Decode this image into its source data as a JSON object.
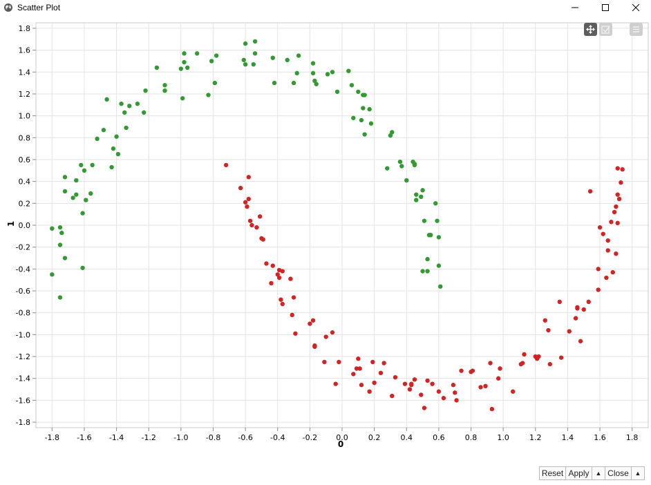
{
  "window": {
    "title": "Scatter Plot",
    "icon": "globe-icon",
    "controls": [
      "minimize-icon",
      "maximize-icon",
      "close-icon"
    ]
  },
  "toolbar": {
    "tools": [
      "pan-icon",
      "select-icon",
      "menu-icon"
    ]
  },
  "buttons": {
    "reset": "Reset",
    "apply": "Apply",
    "close": "Close",
    "apply_menu": "▲",
    "close_menu": "▲"
  },
  "colors": {
    "class_green": "#339933",
    "class_red": "#d22424",
    "grid": "#e3e3e3"
  },
  "chart_data": {
    "type": "scatter",
    "title": "",
    "xlabel": "0",
    "ylabel": "1",
    "xlim": [
      -1.9,
      1.9
    ],
    "ylim": [
      -1.85,
      1.85
    ],
    "xticks": [
      "-1.8",
      "-1.6",
      "-1.4",
      "-1.2",
      "-1.0",
      "-0.8",
      "-0.6",
      "-0.4",
      "-0.2",
      "0.0",
      "0.2",
      "0.4",
      "0.6",
      "0.8",
      "1.0",
      "1.2",
      "1.4",
      "1.6",
      "1.8"
    ],
    "yticks": [
      "1.8",
      "1.6",
      "1.4",
      "1.2",
      "1.0",
      "0.8",
      "0.6",
      "0.4",
      "0.2",
      "0.0",
      "-0.2",
      "-0.4",
      "-0.6",
      "-0.8",
      "-1.0",
      "-1.2",
      "-1.4",
      "-1.6",
      "-1.8"
    ],
    "grid": true,
    "series": [
      {
        "color": "#339933",
        "points": [
          [
            -1.8,
            -0.45
          ],
          [
            -1.8,
            -0.03
          ],
          [
            -1.75,
            -0.02
          ],
          [
            -1.74,
            -0.07
          ],
          [
            -1.75,
            -0.18
          ],
          [
            -1.75,
            -0.66
          ],
          [
            -1.72,
            -0.3
          ],
          [
            -1.72,
            0.44
          ],
          [
            -1.72,
            0.31
          ],
          [
            -1.67,
            0.25
          ],
          [
            -1.65,
            0.41
          ],
          [
            -1.65,
            0.28
          ],
          [
            -1.62,
            0.55
          ],
          [
            -1.61,
            0.11
          ],
          [
            -1.6,
            0.5
          ],
          [
            -1.59,
            0.23
          ],
          [
            -1.61,
            -0.39
          ],
          [
            -1.56,
            0.29
          ],
          [
            -1.55,
            0.55
          ],
          [
            -1.52,
            0.79
          ],
          [
            -1.48,
            0.87
          ],
          [
            -1.46,
            1.15
          ],
          [
            -1.43,
            0.53
          ],
          [
            -1.42,
            0.7
          ],
          [
            -1.4,
            0.81
          ],
          [
            -1.39,
            0.65
          ],
          [
            -1.37,
            1.11
          ],
          [
            -1.35,
            1.03
          ],
          [
            -1.34,
            0.89
          ],
          [
            -1.32,
            1.09
          ],
          [
            -1.27,
            1.11
          ],
          [
            -1.23,
            1.03
          ],
          [
            -1.22,
            1.23
          ],
          [
            -1.15,
            1.44
          ],
          [
            -1.1,
            1.23
          ],
          [
            -1.1,
            1.28
          ],
          [
            -1.0,
            1.43
          ],
          [
            -0.99,
            1.16
          ],
          [
            -0.98,
            1.57
          ],
          [
            -0.98,
            1.49
          ],
          [
            -0.96,
            1.44
          ],
          [
            -0.9,
            1.57
          ],
          [
            -0.83,
            1.19
          ],
          [
            -0.81,
            1.5
          ],
          [
            -0.79,
            1.3
          ],
          [
            -0.78,
            1.55
          ],
          [
            -0.61,
            1.51
          ],
          [
            -0.6,
            1.66
          ],
          [
            -0.6,
            1.47
          ],
          [
            -0.54,
            1.68
          ],
          [
            -0.54,
            1.57
          ],
          [
            -0.55,
            1.47
          ],
          [
            -0.43,
            1.53
          ],
          [
            -0.42,
            1.3
          ],
          [
            -0.34,
            1.51
          ],
          [
            -0.3,
            1.3
          ],
          [
            -0.28,
            1.39
          ],
          [
            -0.27,
            1.55
          ],
          [
            -0.18,
            1.48
          ],
          [
            -0.18,
            1.39
          ],
          [
            -0.17,
            1.32
          ],
          [
            -0.16,
            1.29
          ],
          [
            -0.09,
            1.38
          ],
          [
            -0.06,
            1.4
          ],
          [
            -0.03,
            1.22
          ],
          [
            0.04,
            1.41
          ],
          [
            0.06,
            1.28
          ],
          [
            0.07,
            0.98
          ],
          [
            0.1,
            1.22
          ],
          [
            0.12,
            0.96
          ],
          [
            0.13,
            1.19
          ],
          [
            0.13,
            1.07
          ],
          [
            0.14,
            0.83
          ],
          [
            0.14,
            1.19
          ],
          [
            0.17,
            1.06
          ],
          [
            0.18,
            0.93
          ],
          [
            0.28,
            0.52
          ],
          [
            0.3,
            0.82
          ],
          [
            0.31,
            0.85
          ],
          [
            0.36,
            0.58
          ],
          [
            0.37,
            0.54
          ],
          [
            0.4,
            0.41
          ],
          [
            0.44,
            0.58
          ],
          [
            0.45,
            0.55
          ],
          [
            0.45,
            0.56
          ],
          [
            0.46,
            0.28
          ],
          [
            0.46,
            0.23
          ],
          [
            0.49,
            0.26
          ],
          [
            0.5,
            0.32
          ],
          [
            0.51,
            0.04
          ],
          [
            0.5,
            -0.42
          ],
          [
            0.53,
            -0.31
          ],
          [
            0.53,
            -0.42
          ],
          [
            0.54,
            -0.09
          ],
          [
            0.55,
            -0.09
          ],
          [
            0.58,
            0.2
          ],
          [
            0.59,
            0.04
          ],
          [
            0.6,
            -0.11
          ],
          [
            0.6,
            -0.37
          ],
          [
            0.61,
            -0.56
          ]
        ]
      },
      {
        "color": "#d22424",
        "points": [
          [
            -0.72,
            0.55
          ],
          [
            -0.63,
            0.34
          ],
          [
            -0.6,
            0.21
          ],
          [
            -0.59,
            0.17
          ],
          [
            -0.58,
            0.24
          ],
          [
            -0.58,
            0.44
          ],
          [
            -0.57,
            0.04
          ],
          [
            -0.56,
            0.0
          ],
          [
            -0.53,
            -0.02
          ],
          [
            -0.51,
            0.08
          ],
          [
            -0.5,
            -0.12
          ],
          [
            -0.49,
            -0.13
          ],
          [
            -0.47,
            -0.35
          ],
          [
            -0.44,
            -0.53
          ],
          [
            -0.43,
            -0.37
          ],
          [
            -0.4,
            -0.45
          ],
          [
            -0.39,
            -0.48
          ],
          [
            -0.39,
            -0.41
          ],
          [
            -0.38,
            -0.68
          ],
          [
            -0.37,
            -0.72
          ],
          [
            -0.37,
            -0.42
          ],
          [
            -0.32,
            -0.49
          ],
          [
            -0.31,
            -0.82
          ],
          [
            -0.3,
            -0.66
          ],
          [
            -0.29,
            -0.99
          ],
          [
            -0.2,
            -0.9
          ],
          [
            -0.18,
            -0.87
          ],
          [
            -0.17,
            -1.1
          ],
          [
            -0.17,
            -1.11
          ],
          [
            -0.11,
            -1.25
          ],
          [
            -0.1,
            -1.02
          ],
          [
            -0.06,
            -0.98
          ],
          [
            -0.04,
            -1.45
          ],
          [
            -0.02,
            -1.25
          ],
          [
            0.07,
            -1.36
          ],
          [
            0.09,
            -1.31
          ],
          [
            0.1,
            -1.22
          ],
          [
            0.11,
            -1.31
          ],
          [
            0.12,
            -1.46
          ],
          [
            0.19,
            -1.25
          ],
          [
            0.2,
            -1.44
          ],
          [
            0.17,
            -1.52
          ],
          [
            0.24,
            -1.35
          ],
          [
            0.26,
            -1.26
          ],
          [
            0.31,
            -1.56
          ],
          [
            0.33,
            -1.39
          ],
          [
            0.39,
            -1.45
          ],
          [
            0.42,
            -1.5
          ],
          [
            0.43,
            -1.46
          ],
          [
            0.43,
            -1.45
          ],
          [
            0.45,
            -1.41
          ],
          [
            0.49,
            -1.55
          ],
          [
            0.51,
            -1.67
          ],
          [
            0.53,
            -1.42
          ],
          [
            0.56,
            -1.45
          ],
          [
            0.6,
            -1.52
          ],
          [
            0.63,
            -1.58
          ],
          [
            0.69,
            -1.46
          ],
          [
            0.7,
            -1.53
          ],
          [
            0.71,
            -1.6
          ],
          [
            0.74,
            -1.33
          ],
          [
            0.8,
            -1.34
          ],
          [
            0.81,
            -1.33
          ],
          [
            0.86,
            -1.48
          ],
          [
            0.89,
            -1.47
          ],
          [
            0.92,
            -1.26
          ],
          [
            0.93,
            -1.68
          ],
          [
            0.97,
            -1.4
          ],
          [
            0.98,
            -1.31
          ],
          [
            1.06,
            -1.52
          ],
          [
            1.11,
            -1.27
          ],
          [
            1.12,
            -1.26
          ],
          [
            1.13,
            -1.18
          ],
          [
            1.2,
            -1.2
          ],
          [
            1.21,
            -1.22
          ],
          [
            1.22,
            -1.2
          ],
          [
            1.26,
            -0.87
          ],
          [
            1.28,
            -0.96
          ],
          [
            1.29,
            -1.27
          ],
          [
            1.35,
            -0.7
          ],
          [
            1.36,
            -1.21
          ],
          [
            1.41,
            -0.97
          ],
          [
            1.45,
            -0.85
          ],
          [
            1.46,
            -0.75
          ],
          [
            1.46,
            -0.76
          ],
          [
            1.48,
            -1.06
          ],
          [
            1.5,
            -0.77
          ],
          [
            1.53,
            -0.7
          ],
          [
            1.54,
            0.31
          ],
          [
            1.59,
            -0.59
          ],
          [
            1.59,
            -0.4
          ],
          [
            1.6,
            -0.02
          ],
          [
            1.62,
            -0.08
          ],
          [
            1.64,
            -0.48
          ],
          [
            1.65,
            -0.14
          ],
          [
            1.65,
            -0.23
          ],
          [
            1.67,
            0.03
          ],
          [
            1.68,
            -0.43
          ],
          [
            1.69,
            0.12
          ],
          [
            1.7,
            -0.26
          ],
          [
            1.7,
            0.17
          ],
          [
            1.71,
            0.02
          ],
          [
            1.71,
            0.28
          ],
          [
            1.71,
            0.52
          ],
          [
            1.72,
            0.24
          ],
          [
            1.73,
            0.39
          ],
          [
            1.74,
            0.51
          ]
        ]
      }
    ]
  }
}
